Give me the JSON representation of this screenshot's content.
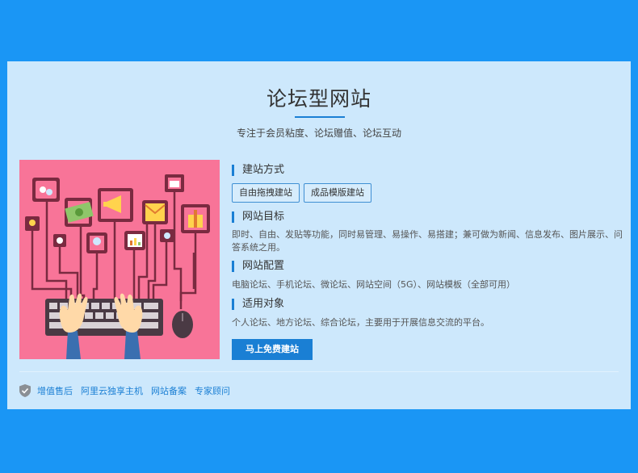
{
  "main": {
    "title": "论坛型网站",
    "subtitle": "专注于会员粘度、论坛赠值、论坛互动"
  },
  "sections": [
    {
      "title": "建站方式",
      "options": [
        "自由拖拽建站",
        "成品模版建站"
      ]
    },
    {
      "title": "网站目标",
      "text": "即时、自由、发贴等功能，同时易管理、易操作、易搭建；兼可做为新闻、信息发布、图片展示、问答系统之用。"
    },
    {
      "title": "网站配置",
      "text": "电脑论坛、手机论坛、微论坛、网站空间（5G）、网站模板（全部可用）"
    },
    {
      "title": "适用对象",
      "text": "个人论坛、地方论坛、综合论坛，主要用于开展信息交流的平台。"
    }
  ],
  "cta_label": "马上免费建站",
  "footer_links": [
    "增值售后",
    "阿里云独享主机",
    "网站备案",
    "专家顾问"
  ],
  "colors": {
    "page_bg": "#1a96f5",
    "card_bg": "#cde8fc",
    "accent": "#1a7fd4",
    "illustration_bg": "#f87498"
  },
  "icons": {
    "footer": "shield-check-icon",
    "illustration": "social-media-keyboard-illustration"
  }
}
